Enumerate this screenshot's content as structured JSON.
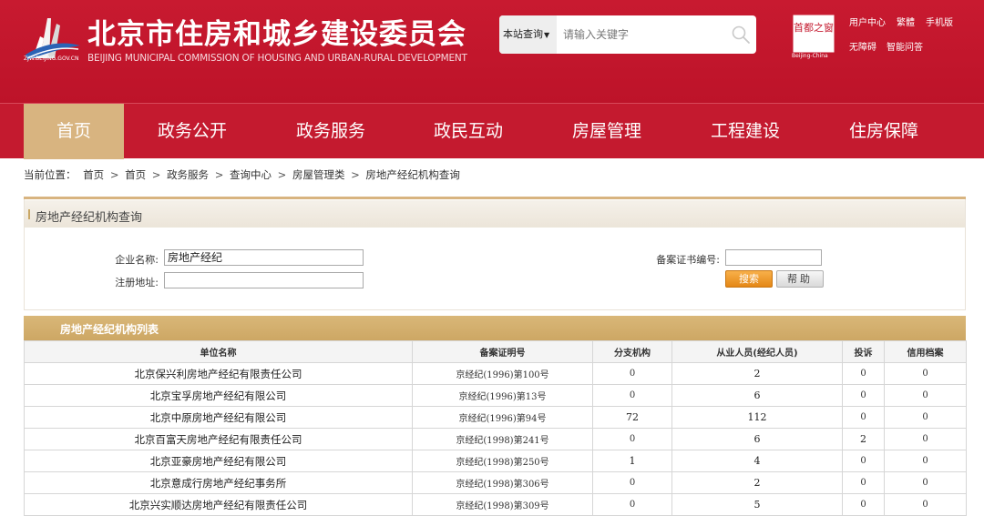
{
  "header": {
    "site_title": "北京市住房和城乡建设委员会",
    "site_subtitle": "BEIJING MUNICIPAL COMMISSION OF HOUSING AND URBAN-RURAL DEVELOPMENT",
    "domain_text": "ZJW.BEIJING.GOV.CN",
    "search_scope": "本站查询",
    "search_placeholder": "请输入关键字",
    "capital_text": "首都之窗",
    "capital_caption": "Beijing-China",
    "links": [
      "用户中心",
      "繁體",
      "手机版",
      "无障碍",
      "智能问答"
    ],
    "brand_color": "#c41a2f",
    "accent_color": "#d8b480"
  },
  "nav": {
    "items": [
      "首页",
      "政务公开",
      "政务服务",
      "政民互动",
      "房屋管理",
      "工程建设",
      "住房保障"
    ],
    "active_index": 0
  },
  "breadcrumb": {
    "prefix": "当前位置：",
    "items": [
      "首页",
      "首页",
      "政务服务",
      "查询中心",
      "房屋管理类",
      "房地产经纪机构查询"
    ]
  },
  "query": {
    "title": "房地产经纪机构查询",
    "company_label": "企业名称:",
    "company_value": "房地产经纪",
    "address_label": "注册地址:",
    "address_value": "",
    "cert_label": "备案证书编号:",
    "cert_value": "",
    "search_button": "搜索",
    "help_button": "帮助"
  },
  "list": {
    "title": "房地产经纪机构列表",
    "columns": [
      "单位名称",
      "备案证明号",
      "分支机构",
      "从业人员(经纪人员)",
      "投诉",
      "信用档案"
    ],
    "rows": [
      [
        "北京保兴利房地产经纪有限责任公司",
        "京经纪(1996)第100号",
        "0",
        "2",
        "0",
        "0"
      ],
      [
        "北京宝孚房地产经纪有限公司",
        "京经纪(1996)第13号",
        "0",
        "6",
        "0",
        "0"
      ],
      [
        "北京中原房地产经纪有限公司",
        "京经纪(1996)第94号",
        "72",
        "112",
        "0",
        "0"
      ],
      [
        "北京百富天房地产经纪有限责任公司",
        "京经纪(1998)第241号",
        "0",
        "6",
        "2",
        "0"
      ],
      [
        "北京亚豪房地产经纪有限公司",
        "京经纪(1998)第250号",
        "1",
        "4",
        "0",
        "0"
      ],
      [
        "北京意成行房地产经纪事务所",
        "京经纪(1998)第306号",
        "0",
        "2",
        "0",
        "0"
      ],
      [
        "北京兴实顺达房地产经纪有限责任公司",
        "京经纪(1998)第309号",
        "0",
        "5",
        "0",
        "0"
      ]
    ]
  }
}
